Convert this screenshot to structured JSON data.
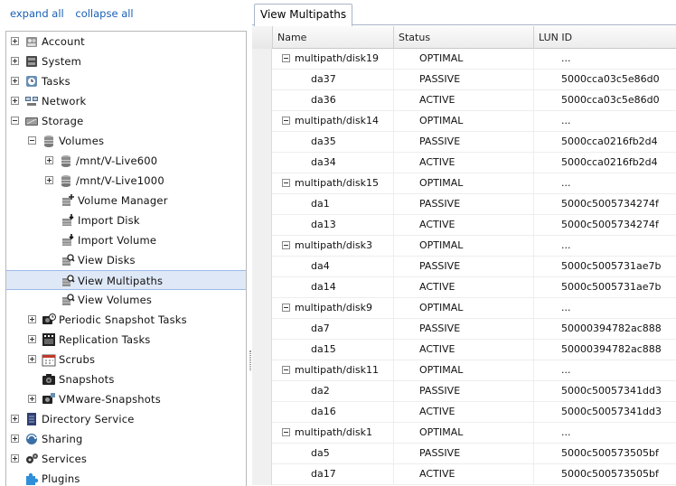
{
  "tree_links": {
    "expand_all": "expand all",
    "collapse_all": "collapse all"
  },
  "tree": [
    {
      "label": "Account",
      "icon": "account-icon",
      "toggle": "plus",
      "level": 0
    },
    {
      "label": "System",
      "icon": "system-icon",
      "toggle": "plus",
      "level": 0
    },
    {
      "label": "Tasks",
      "icon": "tasks-icon",
      "toggle": "plus",
      "level": 0
    },
    {
      "label": "Network",
      "icon": "network-icon",
      "toggle": "plus",
      "level": 0
    },
    {
      "label": "Storage",
      "icon": "storage-icon",
      "toggle": "minus",
      "level": 0
    },
    {
      "label": "Volumes",
      "icon": "volumes-icon",
      "toggle": "minus",
      "level": 1
    },
    {
      "label": "/mnt/V-Live600",
      "icon": "disk-stack-icon",
      "toggle": "plus",
      "level": 2
    },
    {
      "label": "/mnt/V-Live1000",
      "icon": "disk-stack-icon",
      "toggle": "plus",
      "level": 2
    },
    {
      "label": "Volume Manager",
      "icon": "volume-manager-icon",
      "toggle": "",
      "level": 2
    },
    {
      "label": "Import Disk",
      "icon": "import-disk-icon",
      "toggle": "",
      "level": 2
    },
    {
      "label": "Import Volume",
      "icon": "import-volume-icon",
      "toggle": "",
      "level": 2
    },
    {
      "label": "View Disks",
      "icon": "view-disks-icon",
      "toggle": "",
      "level": 2
    },
    {
      "label": "View Multipaths",
      "icon": "view-multipaths-icon",
      "toggle": "",
      "level": 2,
      "selected": true
    },
    {
      "label": "View Volumes",
      "icon": "view-volumes-icon",
      "toggle": "",
      "level": 2
    },
    {
      "label": "Periodic Snapshot Tasks",
      "icon": "periodic-snapshot-icon",
      "toggle": "plus",
      "level": 1
    },
    {
      "label": "Replication Tasks",
      "icon": "replication-icon",
      "toggle": "plus",
      "level": 1
    },
    {
      "label": "Scrubs",
      "icon": "scrubs-calendar-icon",
      "toggle": "plus",
      "level": 1
    },
    {
      "label": "Snapshots",
      "icon": "snapshots-icon",
      "toggle": "",
      "level": 1
    },
    {
      "label": "VMware-Snapshots",
      "icon": "vmware-snapshots-icon",
      "toggle": "plus",
      "level": 1
    },
    {
      "label": "Directory Service",
      "icon": "directory-service-icon",
      "toggle": "plus",
      "level": 0
    },
    {
      "label": "Sharing",
      "icon": "sharing-icon",
      "toggle": "plus",
      "level": 0
    },
    {
      "label": "Services",
      "icon": "services-gear-icon",
      "toggle": "plus",
      "level": 0
    },
    {
      "label": "Plugins",
      "icon": "plugins-puzzle-icon",
      "toggle": "",
      "level": 0
    }
  ],
  "tab": {
    "label": "View Multipaths"
  },
  "grid": {
    "columns": [
      "Name",
      "Status",
      "LUN ID"
    ],
    "rows": [
      {
        "name": "multipath/disk19",
        "status": "OPTIMAL",
        "lun": "...",
        "group": true
      },
      {
        "name": "da37",
        "status": "PASSIVE",
        "lun": "5000cca03c5e86d0"
      },
      {
        "name": "da36",
        "status": "ACTIVE",
        "lun": "5000cca03c5e86d0"
      },
      {
        "name": "multipath/disk14",
        "status": "OPTIMAL",
        "lun": "...",
        "group": true
      },
      {
        "name": "da35",
        "status": "PASSIVE",
        "lun": "5000cca0216fb2d4"
      },
      {
        "name": "da34",
        "status": "ACTIVE",
        "lun": "5000cca0216fb2d4"
      },
      {
        "name": "multipath/disk15",
        "status": "OPTIMAL",
        "lun": "...",
        "group": true
      },
      {
        "name": "da1",
        "status": "PASSIVE",
        "lun": "5000c5005734274f"
      },
      {
        "name": "da13",
        "status": "ACTIVE",
        "lun": "5000c5005734274f"
      },
      {
        "name": "multipath/disk3",
        "status": "OPTIMAL",
        "lun": "...",
        "group": true
      },
      {
        "name": "da4",
        "status": "PASSIVE",
        "lun": "5000c5005731ae7b"
      },
      {
        "name": "da14",
        "status": "ACTIVE",
        "lun": "5000c5005731ae7b"
      },
      {
        "name": "multipath/disk9",
        "status": "OPTIMAL",
        "lun": "...",
        "group": true
      },
      {
        "name": "da7",
        "status": "PASSIVE",
        "lun": "50000394782ac888"
      },
      {
        "name": "da15",
        "status": "ACTIVE",
        "lun": "50000394782ac888"
      },
      {
        "name": "multipath/disk11",
        "status": "OPTIMAL",
        "lun": "...",
        "group": true
      },
      {
        "name": "da2",
        "status": "PASSIVE",
        "lun": "5000c50057341dd3"
      },
      {
        "name": "da16",
        "status": "ACTIVE",
        "lun": "5000c50057341dd3"
      },
      {
        "name": "multipath/disk1",
        "status": "OPTIMAL",
        "lun": "...",
        "group": true
      },
      {
        "name": "da5",
        "status": "PASSIVE",
        "lun": "5000c500573505bf"
      },
      {
        "name": "da17",
        "status": "ACTIVE",
        "lun": "5000c500573505bf"
      }
    ]
  }
}
